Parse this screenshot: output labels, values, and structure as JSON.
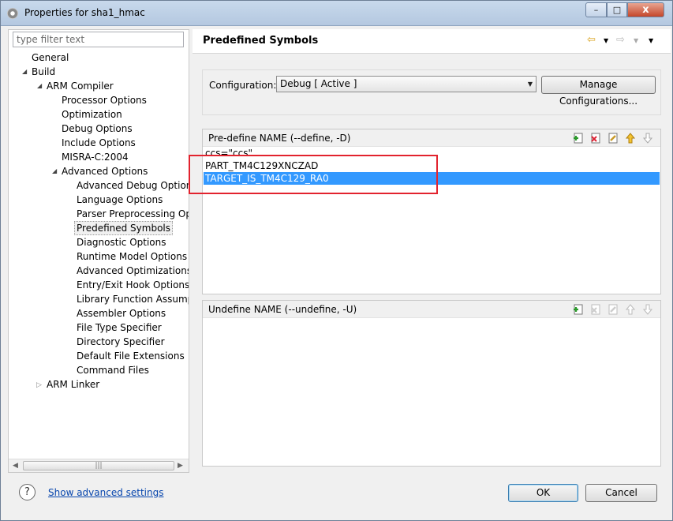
{
  "window": {
    "title": "Properties for sha1_hmac",
    "minimize": "–",
    "maximize": "□",
    "close": "x"
  },
  "filter": {
    "placeholder": "type filter text"
  },
  "tree": {
    "general": "General",
    "build": "Build",
    "arm_compiler": "ARM Compiler",
    "compiler_children": [
      "Processor Options",
      "Optimization",
      "Debug Options",
      "Include Options",
      "MISRA-C:2004"
    ],
    "advanced_options": "Advanced Options",
    "advanced_children": [
      "Advanced Debug Options",
      "Language Options",
      "Parser Preprocessing Opti",
      "Predefined Symbols",
      "Diagnostic Options",
      "Runtime Model Options",
      "Advanced Optimizations",
      "Entry/Exit Hook Options",
      "Library Function Assumpt",
      "Assembler Options",
      "File Type Specifier",
      "Directory Specifier",
      "Default File Extensions",
      "Command Files"
    ],
    "selected": "Predefined Symbols",
    "arm_linker": "ARM Linker"
  },
  "page": {
    "title": "Predefined Symbols"
  },
  "configuration": {
    "label": "Configuration:",
    "value": "Debug  [ Active ]",
    "manage_button": "Manage Configurations..."
  },
  "predefine": {
    "title": "Pre-define NAME (--define, -D)",
    "items": [
      "ccs=\"ccs\"",
      "PART_TM4C129XNCZAD",
      "TARGET_IS_TM4C129_RA0"
    ],
    "selected_index": 2
  },
  "undefine": {
    "title": "Undefine NAME (--undefine, -U)",
    "items": []
  },
  "footer": {
    "help": "?",
    "advanced_link": "Show advanced settings",
    "ok": "OK",
    "cancel": "Cancel"
  },
  "colors": {
    "selection": "#3399ff",
    "highlight_box": "#e2232e",
    "link": "#0645ad"
  }
}
